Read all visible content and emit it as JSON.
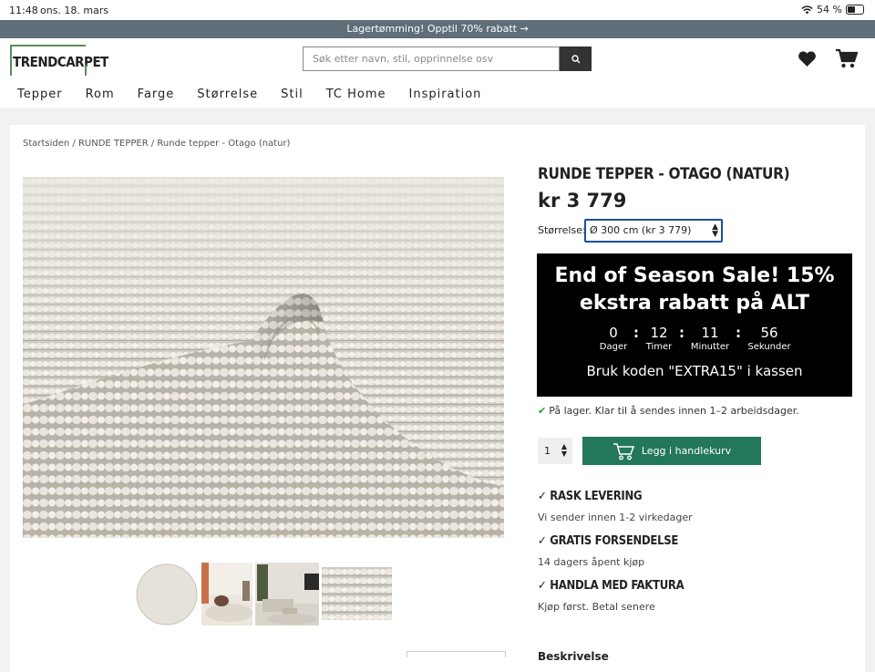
{
  "status_bar": {
    "time": "11:48",
    "date": "ons. 18. mars",
    "battery": "54 %"
  },
  "promo": {
    "text": "Lagertømming! Opptil 70% rabatt →"
  },
  "header": {
    "logo": "TRENDCARPET",
    "search_placeholder": "Søk etter navn, stil, opprinnelse osv",
    "nav": [
      "Tepper",
      "Rom",
      "Farge",
      "Størrelse",
      "Stil",
      "TC Home",
      "Inspiration"
    ]
  },
  "breadcrumb": "Startsiden / RUNDE TEPPER / Runde tepper - Otago (natur)",
  "product": {
    "title": "RUNDE TEPPER - OTAGO (NATUR)",
    "price": "kr 3 779",
    "size_label": "Størrelse:",
    "size_selected": "Ø 300 cm (kr 3 779)",
    "stock": "På lager. Klar til å sendes innen 1–2 arbeidsdager.",
    "qty": "1",
    "add_to_cart": "Legg i handlekurv"
  },
  "sale": {
    "headline": "End of Season Sale! 15% ekstra rabatt på ALT",
    "countdown": [
      {
        "value": "0",
        "label": "Dager"
      },
      {
        "value": "12",
        "label": "Timer"
      },
      {
        "value": "11",
        "label": "Minutter"
      },
      {
        "value": "56",
        "label": "Sekunder"
      }
    ],
    "code_text": "Bruk koden \"EXTRA15\" i kassen"
  },
  "usps": [
    {
      "title": "RASK LEVERING",
      "sub": "Vi sender innen 1-2 virkedager"
    },
    {
      "title": "GRATIS FORSENDELSE",
      "sub": "14 dagers åpent kjøp"
    },
    {
      "title": "HANDLA MED FAKTURA",
      "sub": "Kjøp først. Betal senere"
    }
  ],
  "bottom_heading": "Beskrivelse",
  "colors": {
    "promo_bar": "#5f6e79",
    "add_button": "#23775a",
    "logo_green": "#5b8c5a"
  }
}
